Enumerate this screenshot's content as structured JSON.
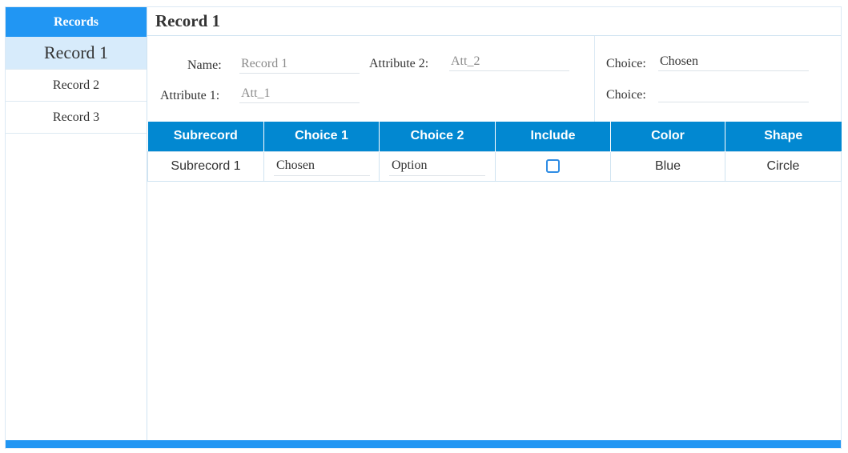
{
  "sidebar": {
    "header": "Records",
    "items": [
      {
        "label": "Record 1"
      },
      {
        "label": "Record 2"
      },
      {
        "label": "Record 3"
      }
    ]
  },
  "record": {
    "title": "Record 1",
    "fields": {
      "name_label": "Name:",
      "name_placeholder": "Record 1",
      "attribute1_label": "Attribute 1:",
      "attribute1_placeholder": "Att_1",
      "attribute2_label": "Attribute 2:",
      "attribute2_placeholder": "Att_2",
      "choice1_label": "Choice:",
      "choice1_value": "Chosen",
      "choice2_label": "Choice:",
      "choice2_value": ""
    }
  },
  "table": {
    "columns": [
      "Subrecord",
      "Choice 1",
      "Choice 2",
      "Include",
      "Color",
      "Shape"
    ],
    "rows": [
      {
        "subrecord": "Subrecord 1",
        "choice1": "Chosen",
        "choice2": "Option",
        "include": false,
        "color": "Blue",
        "shape": "Circle"
      }
    ]
  },
  "colors": {
    "accent": "#2196f3",
    "table_header": "#0288d1",
    "selected_item": "#d7ebfb"
  }
}
